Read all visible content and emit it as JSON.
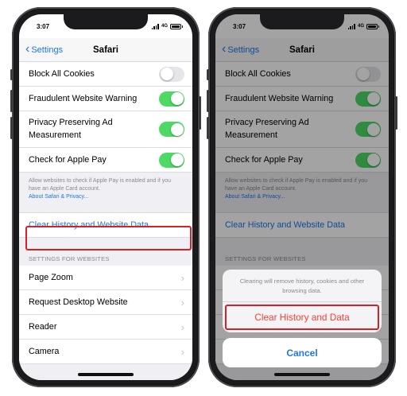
{
  "status": {
    "time": "3:07",
    "network": "4G"
  },
  "nav": {
    "back_label": "Settings",
    "title": "Safari"
  },
  "settings": {
    "rows": [
      {
        "label": "Block All Cookies",
        "on": false
      },
      {
        "label": "Fraudulent Website Warning",
        "on": true
      },
      {
        "label": "Privacy Preserving Ad Measurement",
        "on": true
      },
      {
        "label": "Check for Apple Pay",
        "on": true
      }
    ],
    "footnote_text": "Allow websites to check if Apple Pay is enabled and if you have an Apple Card account.",
    "footnote_link": "About Safari & Privacy...",
    "clear_label": "Clear History and Website Data",
    "section_header": "SETTINGS FOR WEBSITES",
    "website_rows": [
      "Page Zoom",
      "Request Desktop Website",
      "Reader",
      "Camera"
    ]
  },
  "sheet": {
    "message": "Clearing will remove history, cookies and other browsing data.",
    "destructive_label": "Clear History and Data",
    "cancel_label": "Cancel"
  },
  "colors": {
    "accent": "#1e76e8",
    "toggle_on": "#4cd964",
    "destructive": "#ff3b30",
    "highlight": "#d61f26"
  }
}
